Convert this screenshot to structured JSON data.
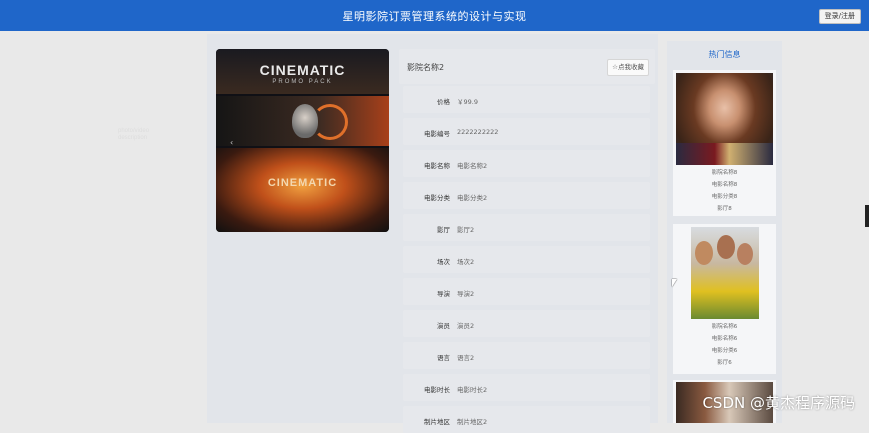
{
  "header": {
    "title": "星明影院订票管理系统的设计与实现",
    "login_label": "登录/注册"
  },
  "poster": {
    "word_top": "CINEMATIC",
    "subword_top": "PROMO PACK",
    "side_text_1": "photo/video",
    "side_text_2": "description",
    "word_bottom": "CINEMATIC"
  },
  "movie": {
    "cinema_name": "影院名称2",
    "favorite_label": "☆点我收藏",
    "fields": [
      {
        "label": "价格",
        "value": "￥99.9"
      },
      {
        "label": "电影编号",
        "value": "2222222222"
      },
      {
        "label": "电影名称",
        "value": "电影名称2"
      },
      {
        "label": "电影分类",
        "value": "电影分类2"
      },
      {
        "label": "影厅",
        "value": "影厅2"
      },
      {
        "label": "场次",
        "value": "场次2"
      },
      {
        "label": "导演",
        "value": "导演2"
      },
      {
        "label": "演员",
        "value": "演员2"
      },
      {
        "label": "语言",
        "value": "语言2"
      },
      {
        "label": "电影时长",
        "value": "电影时长2"
      },
      {
        "label": "制片地区",
        "value": "制片地区2"
      }
    ]
  },
  "hot": {
    "title": "热门信息",
    "items": [
      {
        "lines": [
          "影院名称8",
          "电影名称8",
          "电影分类8",
          "影厅8"
        ]
      },
      {
        "lines": [
          "影院名称6",
          "电影名称6",
          "电影分类6",
          "影厅6"
        ]
      }
    ]
  },
  "watermark": "CSDN @黄杰程序源码",
  "colors": {
    "nav_blue": "#1f66c9",
    "hot_title": "#1f66c9"
  }
}
